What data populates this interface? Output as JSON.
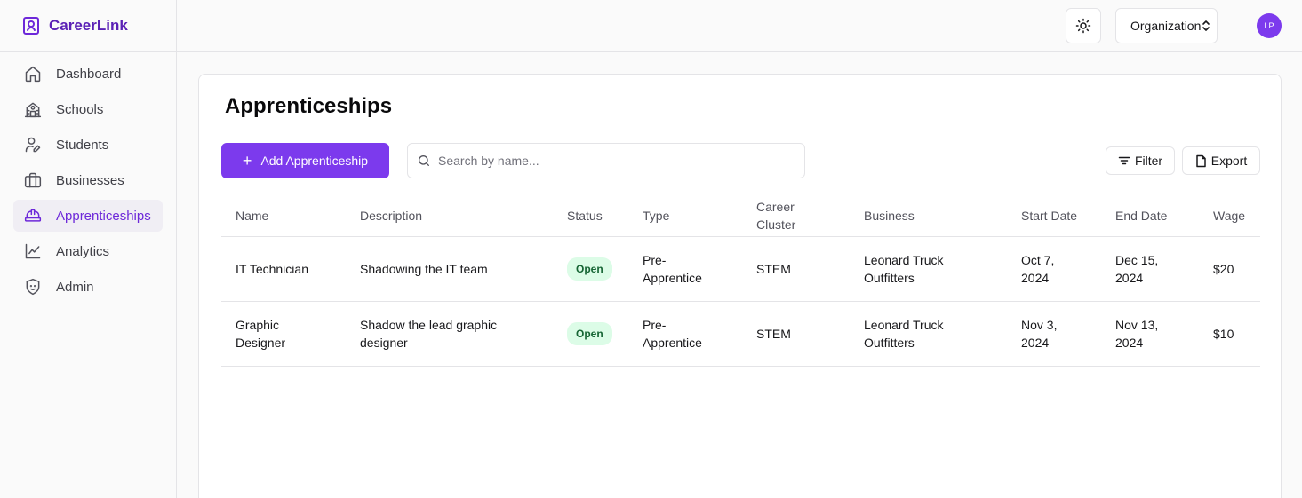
{
  "brand": {
    "name": "CareerLink",
    "icon": "badge-icon",
    "color": "#5b21b6"
  },
  "sidebar": {
    "items": [
      {
        "label": "Dashboard",
        "icon": "home-icon"
      },
      {
        "label": "Schools",
        "icon": "school-icon"
      },
      {
        "label": "Students",
        "icon": "user-edit-icon"
      },
      {
        "label": "Businesses",
        "icon": "briefcase-icon"
      },
      {
        "label": "Apprenticeships",
        "icon": "hard-hat-icon",
        "active": true
      },
      {
        "label": "Analytics",
        "icon": "line-chart-icon"
      },
      {
        "label": "Admin",
        "icon": "shield-icon"
      }
    ]
  },
  "header": {
    "theme_icon": "sun-icon",
    "org_select": {
      "value": "Organization",
      "icon": "chevrons-up-down-icon"
    },
    "avatar_initials": "LP"
  },
  "main": {
    "title": "Apprenticeships",
    "add_button": "Add Apprenticeship",
    "search": {
      "placeholder": "Search by name...",
      "value": ""
    },
    "filter_button": "Filter",
    "export_button": "Export"
  },
  "table": {
    "columns": [
      "Name",
      "Description",
      "Status",
      "Type",
      "Career Cluster",
      "Business",
      "Start Date",
      "End Date",
      "Wage"
    ],
    "rows": [
      [
        "IT Technician",
        "Shadowing the IT team",
        "Open",
        "Pre-Apprentice",
        "STEM",
        "Leonard Truck Outfitters",
        "Oct 7, 2024",
        "Dec 15, 2024",
        "$20"
      ],
      [
        "Graphic Designer",
        "Shadow the lead graphic designer",
        "Open",
        "Pre-Apprentice",
        "STEM",
        "Leonard Truck Outfitters",
        "Nov 3, 2024",
        "Nov 13, 2024",
        "$10"
      ]
    ]
  },
  "colors": {
    "accent": "#7c3aed",
    "open_badge_bg": "#dcfce7",
    "open_badge_text": "#166534"
  }
}
